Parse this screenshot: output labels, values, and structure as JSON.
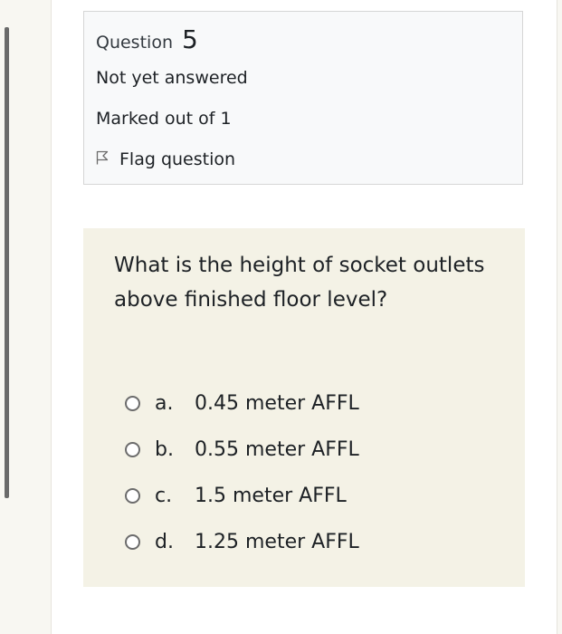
{
  "question_info": {
    "label": "Question",
    "number": "5",
    "state": "Not yet answered",
    "grade": "Marked out of 1",
    "flag_label": "Flag question"
  },
  "question": {
    "text": "What is the height of socket outlets above finished floor level?",
    "answers": [
      {
        "letter": "a.",
        "text": "0.45 meter AFFL"
      },
      {
        "letter": "b.",
        "text": "0.55 meter AFFL"
      },
      {
        "letter": "c.",
        "text": "1.5 meter AFFL"
      },
      {
        "letter": "d.",
        "text": "1.25 meter AFFL"
      }
    ]
  },
  "icons": {
    "flag": "flag-icon",
    "radio": "radio-button"
  },
  "colors": {
    "question_background": "#f4f2e6",
    "info_background": "#f8f9fa",
    "page_background": "#f8f7f2"
  }
}
